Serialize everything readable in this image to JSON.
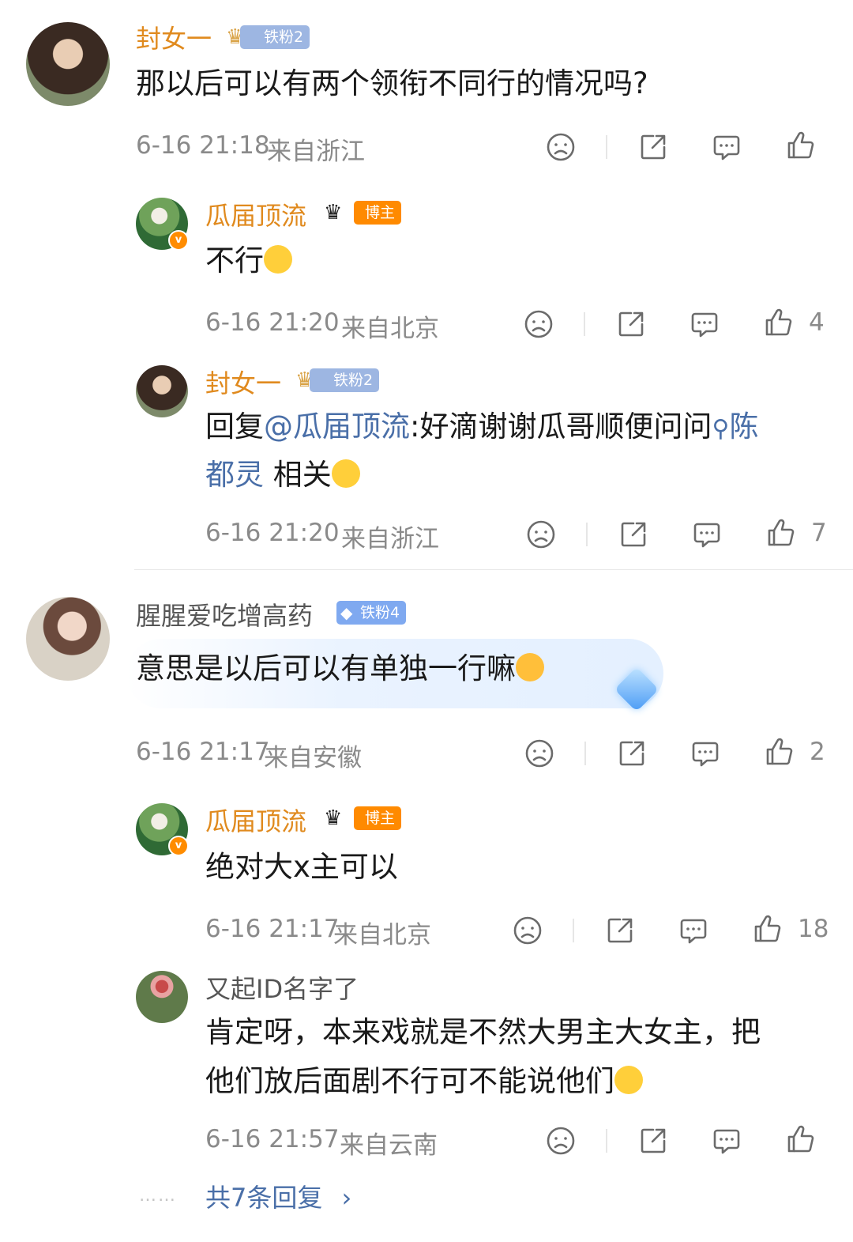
{
  "comments": [
    {
      "username": "封女一",
      "badge": "铁粉2",
      "text": "那以后可以有两个领衔不同行的情况吗?",
      "time": "6-16 21:18",
      "location": "来自浙江",
      "likes": ""
    },
    {
      "username": "瓜届顶流",
      "badge": "博主",
      "text": "不行",
      "time": "6-16 21:20",
      "location": "来自北京",
      "likes": "4"
    },
    {
      "username": "封女一",
      "badge": "铁粉2",
      "reply_prefix": "回复",
      "mention": "@瓜届顶流",
      "text_mid": ":好滴谢谢瓜哥顺便问问",
      "search_topic_1": "陈",
      "search_topic_2": "都灵",
      "text_end": " 相关",
      "time": "6-16 21:20",
      "location": "来自浙江",
      "likes": "7"
    },
    {
      "username": "腥腥爱吃增高药",
      "badge": "铁粉4",
      "text": "意思是以后可以有单独一行嘛",
      "time": "6-16 21:17",
      "location": "来自安徽",
      "likes": "2"
    },
    {
      "username": "瓜届顶流",
      "badge": "博主",
      "text": "绝对大x主可以",
      "time": "6-16 21:17",
      "location": "来自北京",
      "likes": "18"
    },
    {
      "username": "又起ID名字了",
      "text_line1": "肯定呀，本来戏就是不然大男主大女主，把",
      "text_line2": "他们放后面剧不行可不能说他们",
      "time": "6-16 21:57",
      "location": "来自云南",
      "likes": ""
    }
  ],
  "more_replies": {
    "dots": "……",
    "label": "共7条回复",
    "chevron": "›"
  },
  "icons": {
    "dislike": "sad-face-icon",
    "share": "share-icon",
    "comment": "comment-icon",
    "like": "thumbs-up-icon",
    "search": "search-icon"
  },
  "colors": {
    "username_orange": "#e08a1e",
    "link_blue": "#4a6fa8",
    "meta_gray": "#8a8a8a",
    "blogger_badge": "#ff8a00",
    "fan_badge": "#9db6e2"
  }
}
